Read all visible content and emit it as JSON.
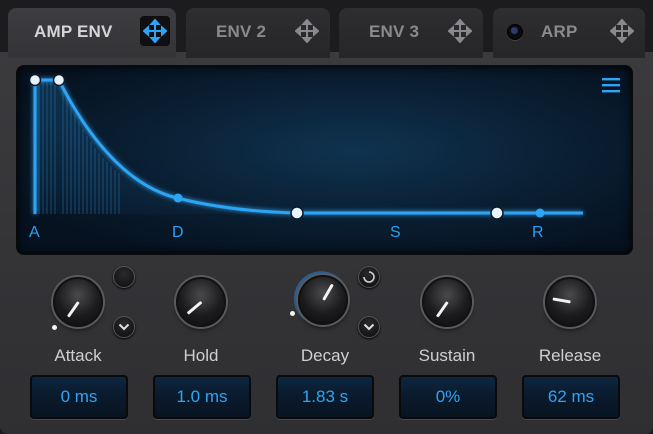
{
  "tabs": [
    {
      "label": "AMP ENV",
      "active": true
    },
    {
      "label": "ENV 2",
      "active": false
    },
    {
      "label": "ENV 3",
      "active": false
    },
    {
      "label": "ARP",
      "active": false
    }
  ],
  "envelope": {
    "markers": [
      "A",
      "D",
      "S",
      "R"
    ],
    "accent_color": "#2ea4f5"
  },
  "knobs": [
    {
      "label": "Attack",
      "value": "0 ms"
    },
    {
      "label": "Hold",
      "value": "1.0 ms"
    },
    {
      "label": "Decay",
      "value": "1.83 s"
    },
    {
      "label": "Sustain",
      "value": "0%"
    },
    {
      "label": "Release",
      "value": "62 ms"
    }
  ]
}
